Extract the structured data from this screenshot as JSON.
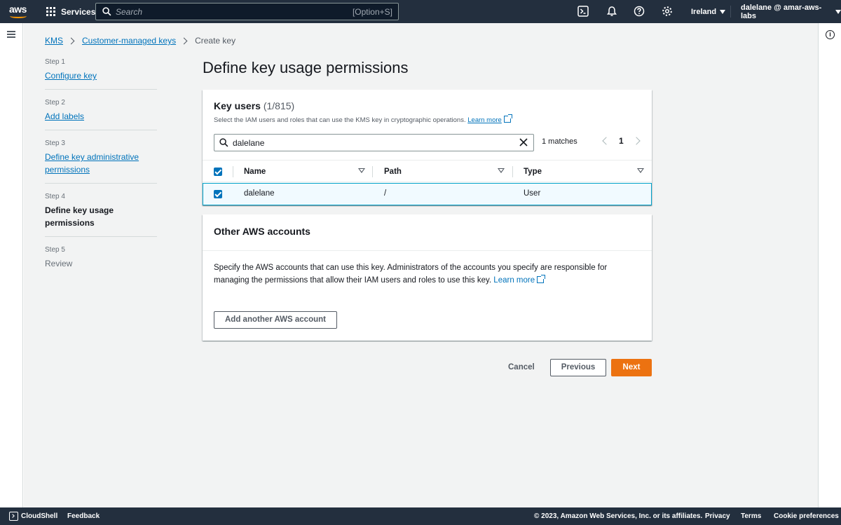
{
  "topnav": {
    "logo": "aws",
    "services_label": "Services",
    "search_placeholder": "Search",
    "search_shortcut": "[Option+S]",
    "region": "Ireland",
    "account": "dalelane @ amar-aws-labs"
  },
  "breadcrumb": [
    "KMS",
    "Customer-managed keys",
    "Create key"
  ],
  "steps": [
    {
      "num": "Step 1",
      "label": "Configure key"
    },
    {
      "num": "Step 2",
      "label": "Add labels"
    },
    {
      "num": "Step 3",
      "label": "Define key administrative permissions"
    },
    {
      "num": "Step 4",
      "label": "Define key usage permissions"
    },
    {
      "num": "Step 5",
      "label": "Review"
    }
  ],
  "page_title": "Define key usage permissions",
  "key_users": {
    "title": "Key users",
    "count": "(1/815)",
    "description": "Select the IAM users and roles that can use the KMS key in cryptographic operations.",
    "learn_more": "Learn more",
    "filter_value": "dalelane",
    "matches": "1 matches",
    "page": "1",
    "columns": [
      "Name",
      "Path",
      "Type"
    ],
    "rows": [
      {
        "name": "dalelane",
        "path": "/",
        "type": "User"
      }
    ]
  },
  "other_accounts": {
    "title": "Other AWS accounts",
    "description": "Specify the AWS accounts that can use this key. Administrators of the accounts you specify are responsible for managing the permissions that allow their IAM users and roles to use this key.",
    "learn_more": "Learn more",
    "add_button": "Add another AWS account"
  },
  "actions": {
    "cancel": "Cancel",
    "previous": "Previous",
    "next": "Next"
  },
  "footer": {
    "cloudshell": "CloudShell",
    "feedback": "Feedback",
    "copyright": "© 2023, Amazon Web Services, Inc. or its affiliates.",
    "privacy": "Privacy",
    "terms": "Terms",
    "cookie": "Cookie preferences"
  },
  "colors": {
    "nav_bg": "#232f3e",
    "link": "#0073bb",
    "primary_button": "#ec7211",
    "page_bg": "#f2f3f3",
    "selected_row": "#f1faff"
  }
}
